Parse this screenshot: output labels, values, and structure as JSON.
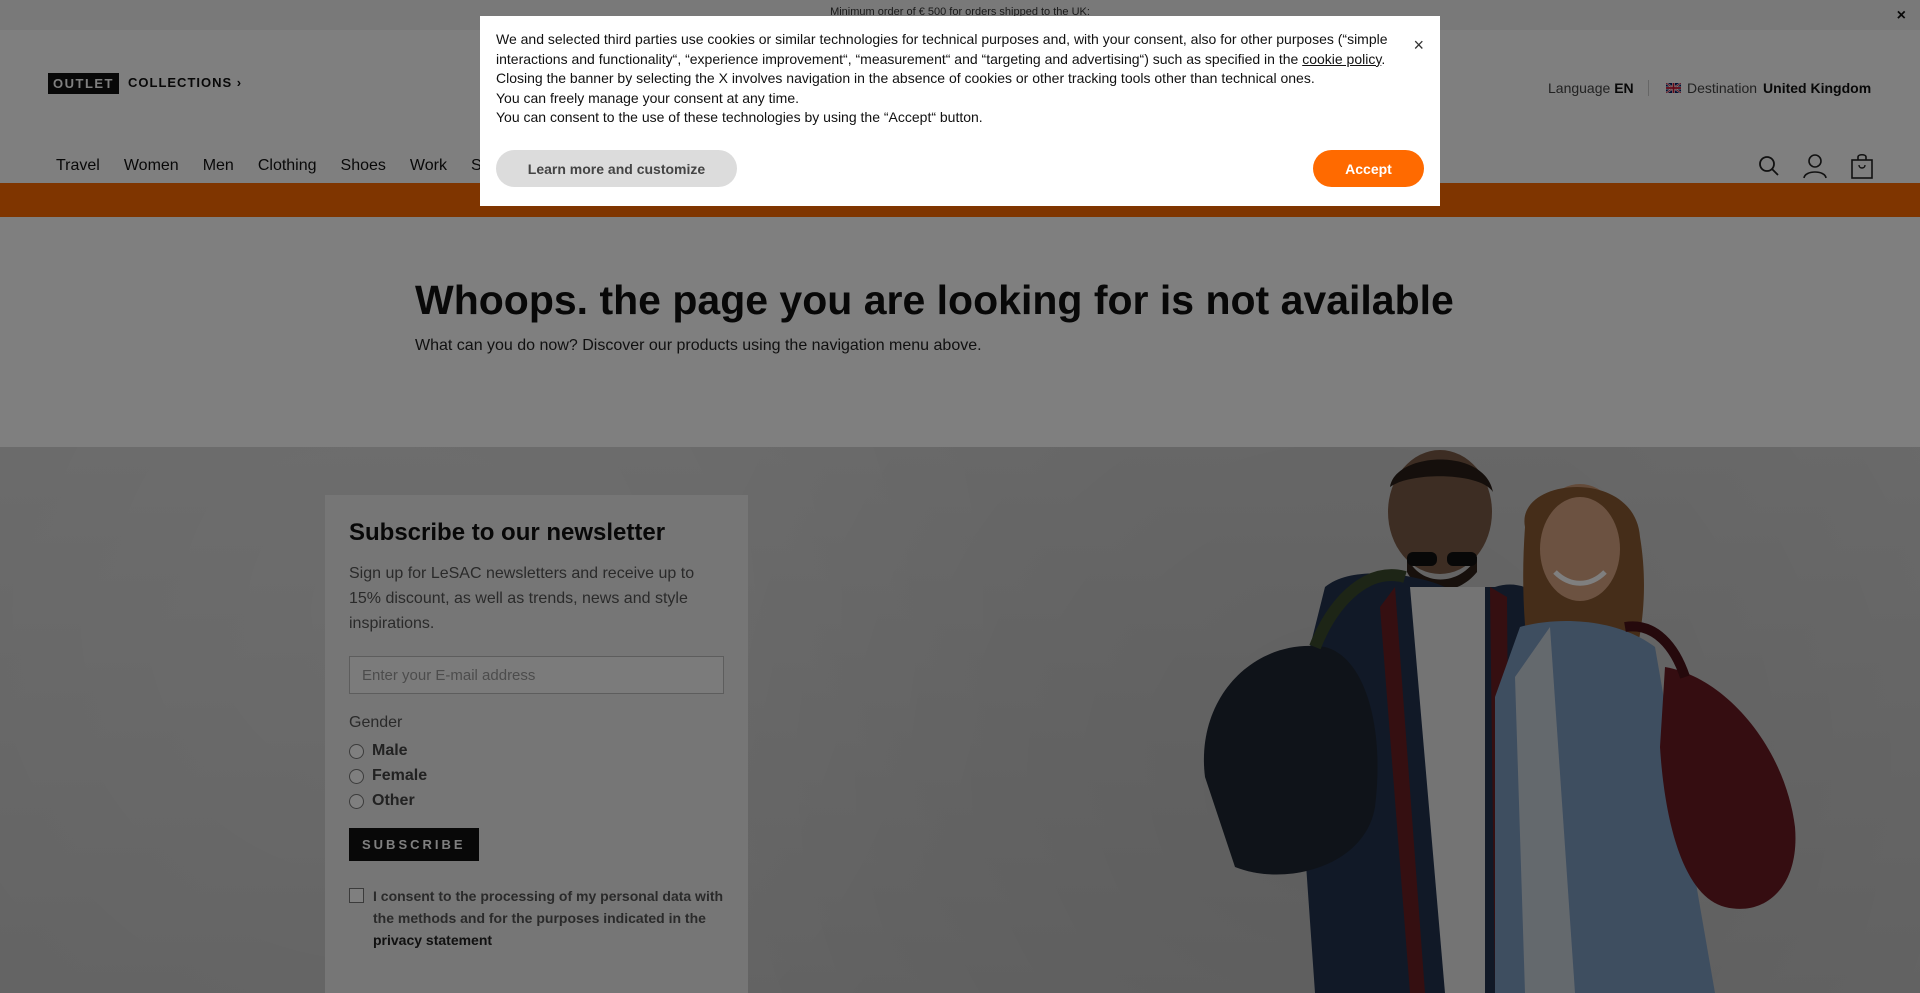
{
  "promo": {
    "text": "Minimum order of € 500 for orders shipped to the UK:",
    "close": "×"
  },
  "header": {
    "outlet": "OUTLET",
    "collections": "COLLECTIONS ›",
    "language_label": "Language",
    "language_value": "EN",
    "destination_label": "Destination",
    "destination_value": "United Kingdom",
    "nav": [
      "Travel",
      "Women",
      "Men",
      "Clothing",
      "Shoes",
      "Work",
      "S"
    ]
  },
  "main": {
    "title": "Whoops. the page you are looking for is not available",
    "subtitle": "What can you do now? Discover our products using the navigation menu above."
  },
  "newsletter": {
    "title": "Subscribe to our newsletter",
    "description": "Sign up for LeSAC newsletters and receive up to 15% discount, as well as trends, news and style inspirations.",
    "email_placeholder": "Enter your E-mail address",
    "gender_label": "Gender",
    "options": [
      "Male",
      "Female",
      "Other"
    ],
    "subscribe": "SUBSCRIBE",
    "consent_text": "I consent to the processing of my personal data with the methods and for the purposes indicated in the",
    "consent_link": "privacy statement"
  },
  "cookie": {
    "line1_pre": "We and selected third parties use cookies or similar technologies for technical purposes and, with your consent, also for other purposes (“simple interactions and functionality“, “experience improvement“, “measurement“ and “targeting and advertising“) such as specified in the",
    "line1_link": "cookie policy",
    "line2": "Closing the banner by selecting the X involves navigation in the absence of cookies or other tracking tools other than technical ones.",
    "line3": "You can freely manage your consent at any time.",
    "line4": "You can consent to the use of these technologies by using the “Accept“ button.",
    "close": "×",
    "learn_more": "Learn more and customize",
    "accept": "Accept"
  },
  "colors": {
    "accent": "#ff6a00",
    "overlay": "rgba(0,0,0,0.5)"
  }
}
